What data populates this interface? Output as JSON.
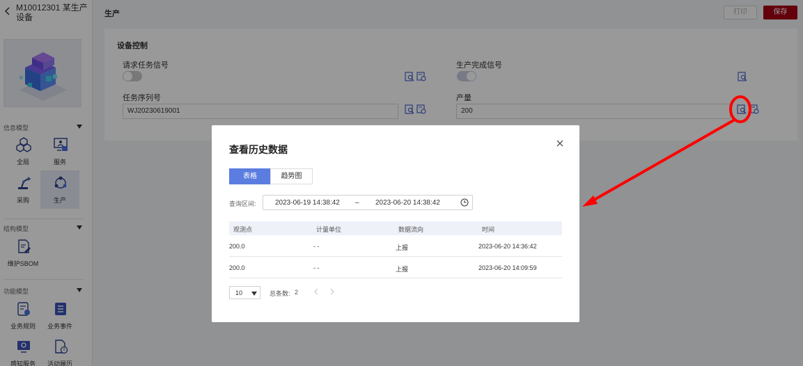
{
  "sidebar": {
    "title": "M10012301 某生产设备",
    "sections": [
      {
        "label": "信息模型",
        "items": [
          {
            "label": "全局"
          },
          {
            "label": "服务"
          },
          {
            "label": "采购"
          },
          {
            "label": "生产"
          }
        ]
      },
      {
        "label": "结构模型",
        "items": [
          {
            "label": "维护SBOM"
          }
        ]
      },
      {
        "label": "功能模型",
        "items": [
          {
            "label": "业务规则"
          },
          {
            "label": "业务事件"
          },
          {
            "label": "感知服务"
          },
          {
            "label": "活动履历"
          }
        ]
      }
    ],
    "active_item": "生产"
  },
  "header": {
    "title": "生产",
    "print_label": "打印",
    "save_label": "保存"
  },
  "device_control": {
    "title": "设备控制",
    "fields": {
      "request_task_signal": {
        "label": "请求任务信号",
        "state": "off"
      },
      "production_done_signal": {
        "label": "生产完成信号",
        "state": "on"
      },
      "task_serial": {
        "label": "任务序列号",
        "value": "WJ20230619001"
      },
      "output": {
        "label": "产量",
        "value": "200"
      }
    }
  },
  "modal": {
    "title": "查看历史数据",
    "tabs": [
      {
        "label": "表格",
        "active": true
      },
      {
        "label": "趋势图",
        "active": false
      }
    ],
    "range": {
      "label": "查询区间:",
      "start": "2023-06-19 14:38:42",
      "separator": "–",
      "end": "2023-06-20 14:38:42"
    },
    "table": {
      "columns": [
        "观测点",
        "计量单位",
        "数据流向",
        "时间"
      ],
      "rows": [
        [
          "200.0",
          "- -",
          "上报",
          "2023-06-20 14:36:42"
        ],
        [
          "200.0",
          "- -",
          "上报",
          "2023-06-20 14:09:59"
        ]
      ]
    },
    "pager": {
      "page_size": "10",
      "total_label": "总条数:",
      "total": "2"
    }
  },
  "colors": {
    "accent": "#5b7de0",
    "save_button": "#a50013",
    "annotation": "#ff0000"
  }
}
